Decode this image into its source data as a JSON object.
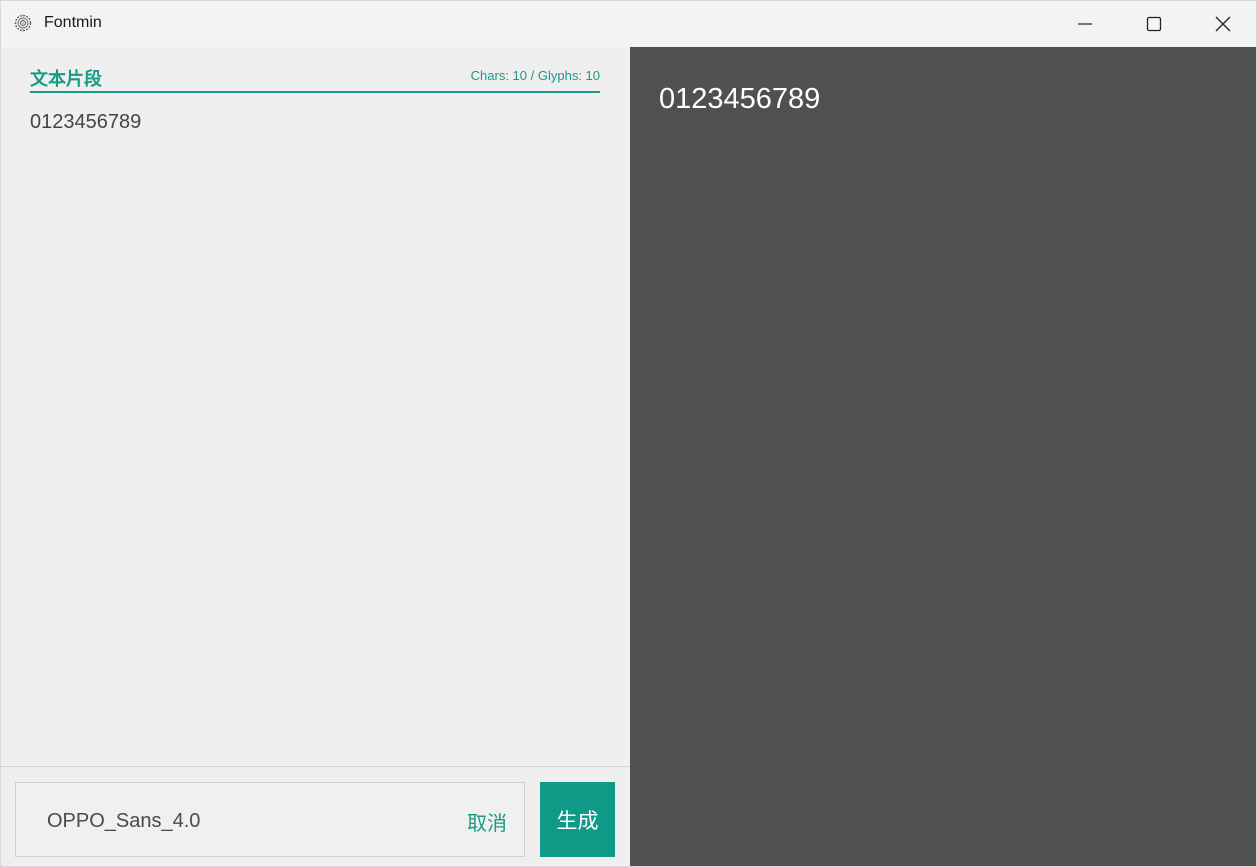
{
  "window": {
    "title": "Fontmin",
    "icon": "fontmin-gear-icon",
    "controls": [
      "minimize-icon",
      "maximize-icon",
      "close-icon"
    ]
  },
  "editor": {
    "section_title": "文本片段",
    "counter": "Chars: 10 / Glyphs: 10",
    "text": "0123456789"
  },
  "footer": {
    "font_name": "OPPO_Sans_4.0",
    "cancel_label": "取消",
    "generate_label": "生成"
  },
  "preview": {
    "text": "0123456789"
  },
  "colors": {
    "accent": "#1a9a86",
    "preview_bg": "#505050",
    "panel_bg": "#efefef"
  }
}
